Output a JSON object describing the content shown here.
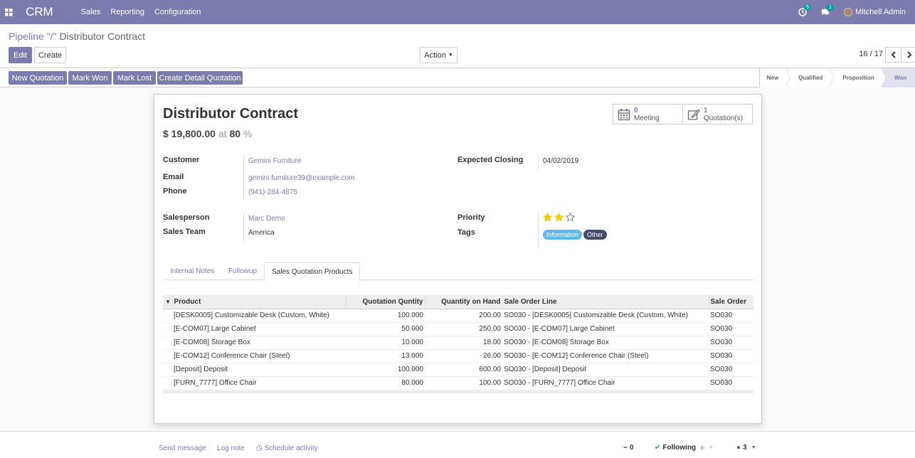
{
  "navbar": {
    "brand": "CRM",
    "menu": [
      "Sales",
      "Reporting",
      "Configuration"
    ],
    "activity_count": "5",
    "message_count": "1",
    "user_name": "Mitchell Admin"
  },
  "control": {
    "breadcrumb_parent": "Pipeline \"/\"",
    "breadcrumb_current": "Distributor Contract",
    "edit_label": "Edit",
    "create_label": "Create",
    "action_label": "Action",
    "pager": "16 / 17"
  },
  "statusbar": {
    "buttons": [
      "New Quotation",
      "Mark Won",
      "Mark Lost",
      "Create Detail Quotation"
    ],
    "stages": [
      "New",
      "Qualified",
      "Proposition",
      "Won"
    ],
    "active_stage": "Won"
  },
  "record": {
    "title": "Distributor Contract",
    "revenue": "$ 19,800.00",
    "at": "at",
    "probability": "80",
    "percent": "%",
    "meetings": {
      "count": "0",
      "label": "Meeting"
    },
    "quotations": {
      "count": "1",
      "label": "Quotation(s)"
    },
    "fields": {
      "customer_label": "Customer",
      "customer": "Gemini Furniture",
      "email_label": "Email",
      "email": "gemini.furniture39@example.com",
      "phone_label": "Phone",
      "phone": "(941)-284-4875",
      "salesperson_label": "Salesperson",
      "salesperson": "Marc Demo",
      "team_label": "Sales Team",
      "team": "America",
      "closing_label": "Expected Closing",
      "closing": "04/02/2019",
      "priority_label": "Priority",
      "priority": 2,
      "priority_max": 3,
      "tags_label": "Tags",
      "tags": [
        {
          "name": "Information",
          "color": "#5eb8e8"
        },
        {
          "name": "Other",
          "color": "#454b6b"
        }
      ]
    }
  },
  "tabs": [
    "Internal Notes",
    "Followup",
    "Sales Quotation Products"
  ],
  "table": {
    "headers": [
      "Product",
      "Quotation Quntity",
      "Quantity on Hand",
      "Sale Order Line",
      "Sale Order"
    ],
    "rows": [
      [
        "[DESK0005] Customizable Desk (Custom, White)",
        "100.000",
        "200.00",
        "SO030 - [DESK0005] Customizable Desk (Custom, White)",
        "SO030"
      ],
      [
        "[E-COM07] Large Cabinet",
        "50.000",
        "250.00",
        "SO030 - [E-COM07] Large Cabinet",
        "SO030"
      ],
      [
        "[E-COM08] Storage Box",
        "10.000",
        "18.00",
        "SO030 - [E-COM08] Storage Box",
        "SO030"
      ],
      [
        "[E-COM12] Conference Chair (Steel)",
        "13.000",
        "26.00",
        "SO030 - [E-COM12] Conference Chair (Steel)",
        "SO030"
      ],
      [
        "[Deposit] Deposit",
        "100.000",
        "600.00",
        "SO030 - [Deposit] Deposit",
        "SO030"
      ],
      [
        "[FURN_7777] Office Chair",
        "80.000",
        "100.00",
        "SO030 - [FURN_7777] Office Chair",
        "SO030"
      ]
    ]
  },
  "chatter": {
    "send_message": "Send message",
    "log_note": "Log note",
    "schedule_activity": "Schedule activity",
    "attachments": "0",
    "following": "Following",
    "followers": "3"
  }
}
